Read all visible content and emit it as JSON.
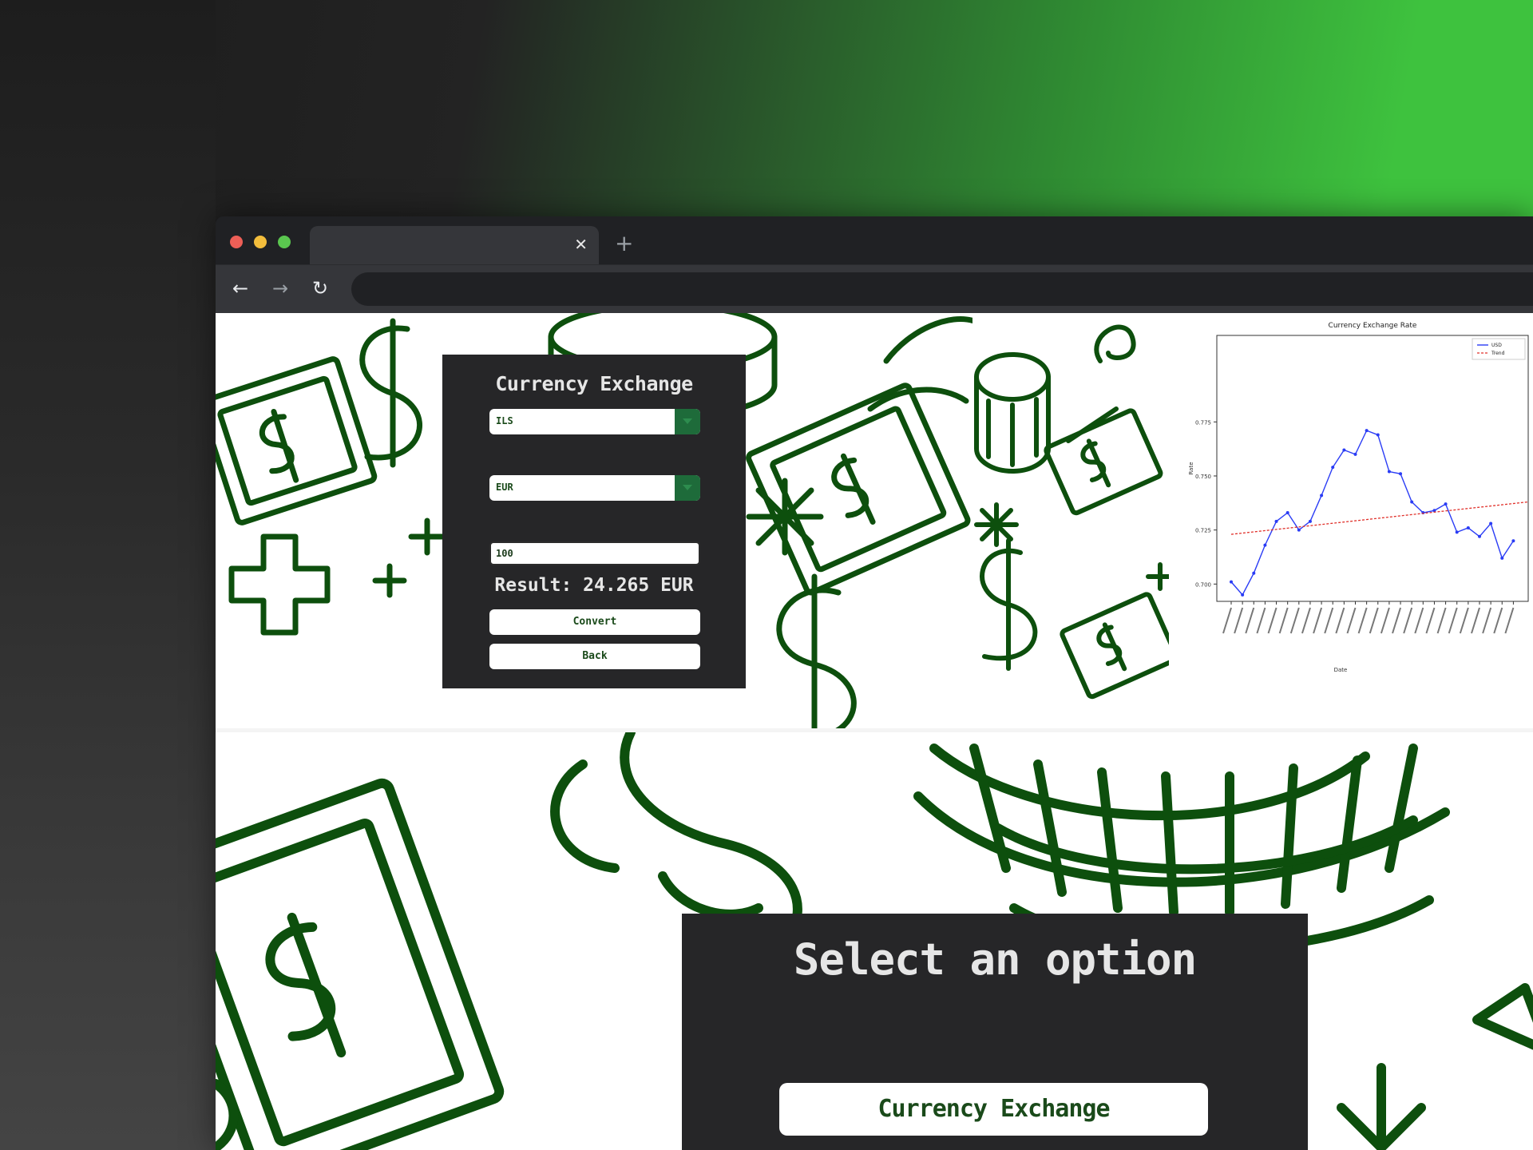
{
  "browser": {
    "tab_title": "",
    "tab_close_glyph": "✕",
    "new_tab_glyph": "+",
    "nav": {
      "back_glyph": "←",
      "forward_glyph": "→",
      "reload_glyph": "↻"
    },
    "url": ""
  },
  "exchange_dialog": {
    "title": "Currency Exchange",
    "from_currency": "ILS",
    "to_currency": "EUR",
    "amount": "100",
    "result": "Result: 24.265 EUR",
    "convert_label": "Convert",
    "back_label": "Back"
  },
  "chart_data": {
    "type": "line",
    "title": "Currency Exchange Rate",
    "xlabel": "Date",
    "ylabel": "Rate",
    "legend": [
      "USD",
      "Trend"
    ],
    "legend_position": "top-right",
    "grid": false,
    "yticks": [
      "0.775",
      "0.750",
      "0.725",
      "0.700"
    ],
    "ylim": [
      0.692,
      0.815
    ],
    "series": [
      {
        "name": "USD",
        "color": "#2a3cf5",
        "values": [
          0.701,
          0.695,
          0.705,
          0.718,
          0.729,
          0.733,
          0.725,
          0.729,
          0.741,
          0.754,
          0.762,
          0.76,
          0.771,
          0.769,
          0.752,
          0.751,
          0.738,
          0.733,
          0.734,
          0.737,
          0.724,
          0.726,
          0.722,
          0.728,
          0.712,
          0.72
        ]
      },
      {
        "name": "Trend",
        "color": "#e0302a",
        "values": [
          0.723,
          0.738
        ]
      }
    ]
  },
  "select_dialog": {
    "title": "Select an option",
    "currency_exchange_label": "Currency Exchange"
  },
  "colors": {
    "pattern_green": "#0d4f0d",
    "dialog_bg": "#262628",
    "accent_green": "#1e6b3a"
  }
}
